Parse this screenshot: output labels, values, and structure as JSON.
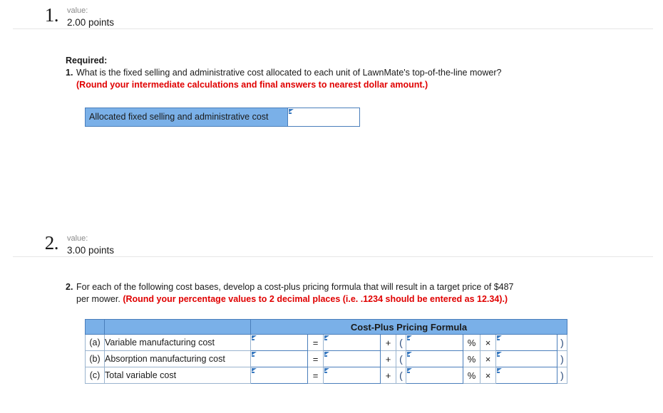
{
  "colors": {
    "header_blue": "#7ab0e8",
    "border_blue": "#4a7ebb",
    "red_text": "#e00000",
    "divider": "#e6e6e6"
  },
  "questions": [
    {
      "number": "1.",
      "value_label": "value:",
      "points": "2.00 points",
      "required_label": "Required:",
      "item_number": "1.",
      "text_plain": "What is the fixed selling and administrative cost allocated to each unit of LawnMate's top-of-the-line mower? ",
      "text_red": "(Round your intermediate calculations and final answers to nearest dollar amount.)",
      "answer_row": {
        "label": "Allocated fixed selling and administrative cost",
        "input_value": "",
        "input_placeholder": ""
      }
    },
    {
      "number": "2.",
      "value_label": "value:",
      "points": "3.00 points",
      "item_number": "2.",
      "text_plain": "For each of the following cost bases, develop a cost-plus pricing formula that will result in a target price of $487 per mower. ",
      "text_red": "(Round your percentage values to 2 decimal places (i.e. .1234 should be entered as 12.34).)",
      "table": {
        "header_title": "Cost-Plus Pricing Formula",
        "operators": {
          "equals": "=",
          "plus": "+",
          "open_paren": "(",
          "percent": "%",
          "times": "×",
          "close_paren": ")"
        },
        "rows": [
          {
            "index": "(a)",
            "name": "Variable manufacturing cost",
            "price": "",
            "base": "",
            "markup_pct": "",
            "multiplier": ""
          },
          {
            "index": "(b)",
            "name": "Absorption manufacturing cost",
            "price": "",
            "base": "",
            "markup_pct": "",
            "multiplier": ""
          },
          {
            "index": "(c)",
            "name": "Total variable cost",
            "price": "",
            "base": "",
            "markup_pct": "",
            "multiplier": ""
          }
        ]
      }
    }
  ]
}
